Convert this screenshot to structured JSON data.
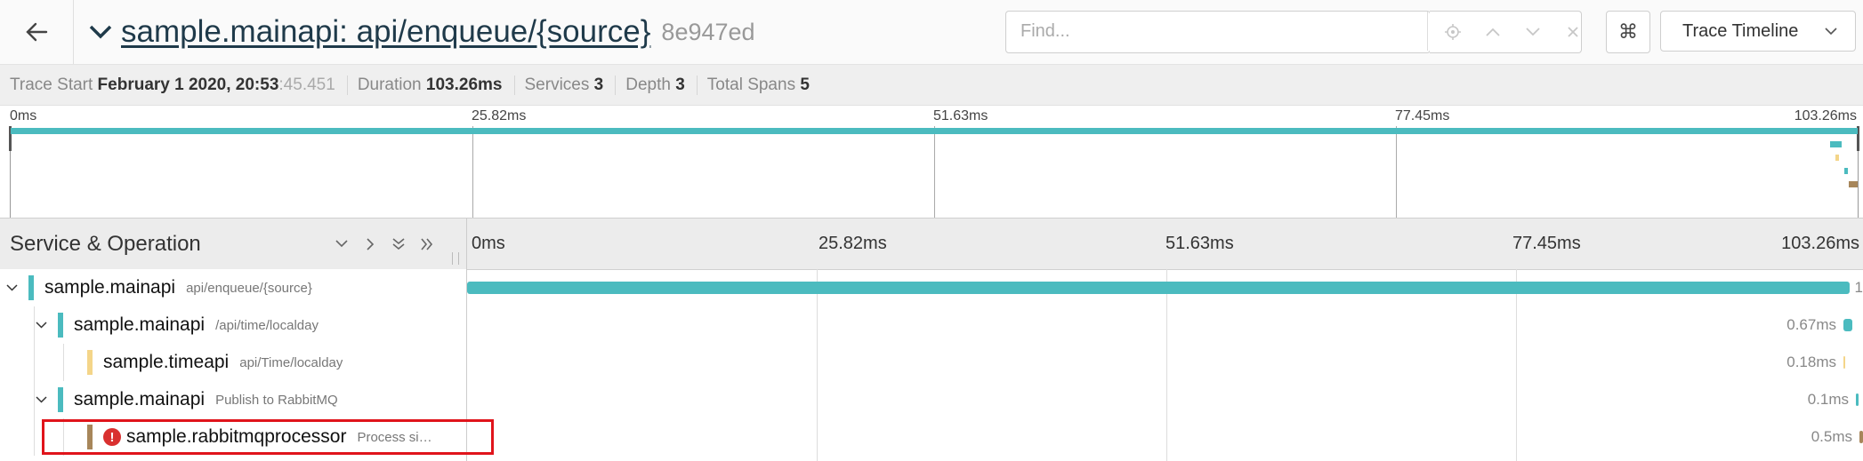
{
  "header": {
    "title": "sample.mainapi: api/enqueue/{source}",
    "trace_id": "8e947ed",
    "find_placeholder": "Find...",
    "kbd_icon": "⌘",
    "view_mode": "Trace Timeline"
  },
  "summary": {
    "trace_start_label": "Trace Start",
    "trace_start_value": "February 1 2020, 20:53",
    "trace_start_ms": ":45.451",
    "duration_label": "Duration",
    "duration_value": "103.26ms",
    "services_label": "Services",
    "services_value": "3",
    "depth_label": "Depth",
    "depth_value": "3",
    "total_spans_label": "Total Spans",
    "total_spans_value": "5"
  },
  "ticks": [
    "0ms",
    "25.82ms",
    "51.63ms",
    "77.45ms",
    "103.26ms"
  ],
  "timeline": {
    "column_title": "Service & Operation"
  },
  "colors": {
    "mainapi": "#4bbbbf",
    "timeapi": "#f4d589",
    "rabbitmqprocessor": "#a7865a",
    "error": "#d9302f",
    "highlight": "#e0141b"
  },
  "spans": [
    {
      "service": "sample.mainapi",
      "operation": "api/enqueue/{source}",
      "depth": 0,
      "color_key": "mainapi",
      "start_ms": 0,
      "duration_ms": 103.26,
      "duration_label": "1",
      "collapsible": true,
      "error": false
    },
    {
      "service": "sample.mainapi",
      "operation": "/api/time/localday",
      "depth": 1,
      "color_key": "mainapi",
      "start_ms": 101.7,
      "duration_ms": 0.67,
      "duration_label": "0.67ms",
      "collapsible": true,
      "error": false
    },
    {
      "service": "sample.timeapi",
      "operation": "api/Time/localday",
      "depth": 2,
      "color_key": "timeapi",
      "start_ms": 102.0,
      "duration_ms": 0.18,
      "duration_label": "0.18ms",
      "collapsible": false,
      "error": false
    },
    {
      "service": "sample.mainapi",
      "operation": "Publish to RabbitMQ",
      "depth": 1,
      "color_key": "mainapi",
      "start_ms": 102.5,
      "duration_ms": 0.1,
      "duration_label": "0.1ms",
      "collapsible": true,
      "error": false
    },
    {
      "service": "sample.rabbitmqprocessor",
      "operation": "Process si…",
      "depth": 2,
      "color_key": "rabbitmqprocessor",
      "start_ms": 102.76,
      "duration_ms": 0.5,
      "duration_label": "0.5ms",
      "collapsible": false,
      "error": true
    }
  ]
}
